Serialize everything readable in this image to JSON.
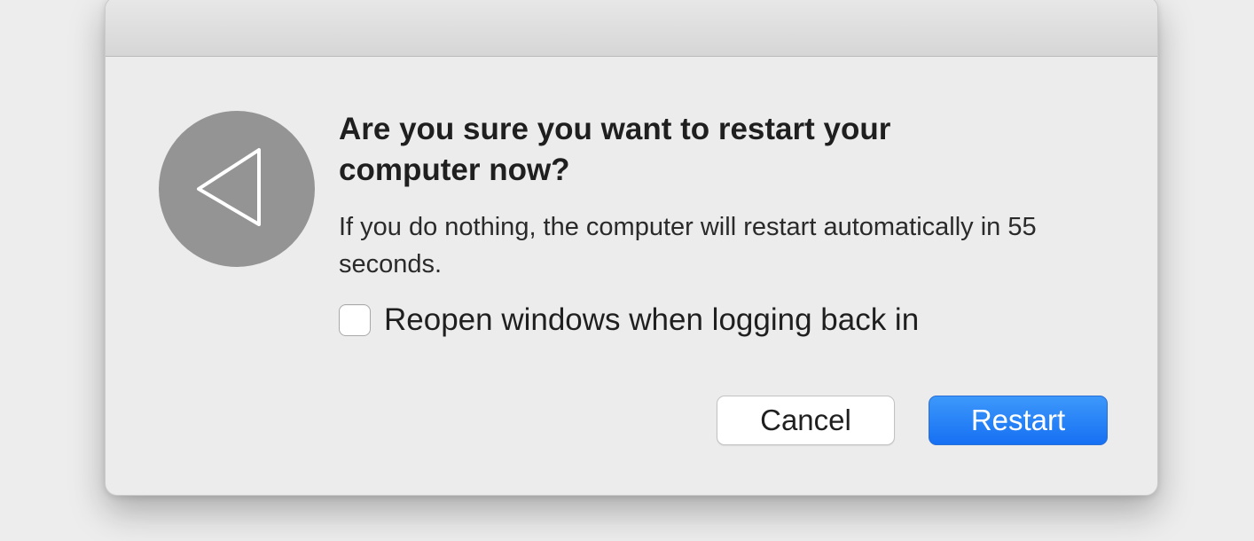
{
  "dialog": {
    "title": "Are you sure you want to restart your computer now?",
    "message": "If you do nothing, the computer will restart automatically in 55 seconds.",
    "checkbox": {
      "label": "Reopen windows when logging back in",
      "checked": false
    },
    "buttons": {
      "cancel_label": "Cancel",
      "restart_label": "Restart"
    },
    "icon": "restart-triangle-icon"
  },
  "colors": {
    "primary_button": "#1a75f5",
    "icon_background": "#949494"
  }
}
